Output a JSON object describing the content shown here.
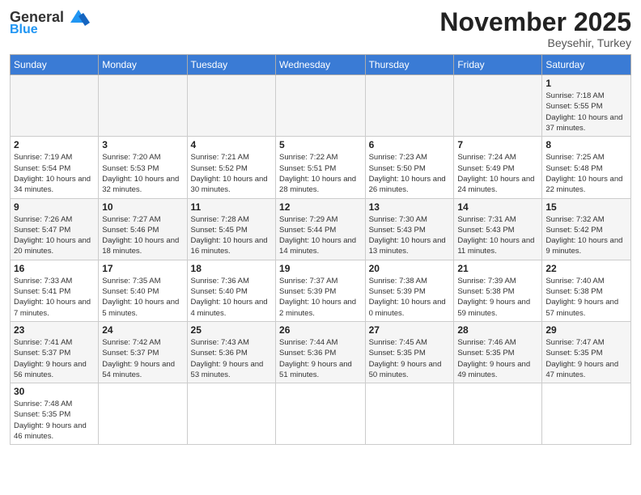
{
  "header": {
    "logo_general": "General",
    "logo_blue": "Blue",
    "month_title": "November 2025",
    "location": "Beysehir, Turkey"
  },
  "weekdays": [
    "Sunday",
    "Monday",
    "Tuesday",
    "Wednesday",
    "Thursday",
    "Friday",
    "Saturday"
  ],
  "weeks": [
    [
      {
        "day": "",
        "info": ""
      },
      {
        "day": "",
        "info": ""
      },
      {
        "day": "",
        "info": ""
      },
      {
        "day": "",
        "info": ""
      },
      {
        "day": "",
        "info": ""
      },
      {
        "day": "",
        "info": ""
      },
      {
        "day": "1",
        "info": "Sunrise: 7:18 AM\nSunset: 5:55 PM\nDaylight: 10 hours and 37 minutes."
      }
    ],
    [
      {
        "day": "2",
        "info": "Sunrise: 7:19 AM\nSunset: 5:54 PM\nDaylight: 10 hours and 34 minutes."
      },
      {
        "day": "3",
        "info": "Sunrise: 7:20 AM\nSunset: 5:53 PM\nDaylight: 10 hours and 32 minutes."
      },
      {
        "day": "4",
        "info": "Sunrise: 7:21 AM\nSunset: 5:52 PM\nDaylight: 10 hours and 30 minutes."
      },
      {
        "day": "5",
        "info": "Sunrise: 7:22 AM\nSunset: 5:51 PM\nDaylight: 10 hours and 28 minutes."
      },
      {
        "day": "6",
        "info": "Sunrise: 7:23 AM\nSunset: 5:50 PM\nDaylight: 10 hours and 26 minutes."
      },
      {
        "day": "7",
        "info": "Sunrise: 7:24 AM\nSunset: 5:49 PM\nDaylight: 10 hours and 24 minutes."
      },
      {
        "day": "8",
        "info": "Sunrise: 7:25 AM\nSunset: 5:48 PM\nDaylight: 10 hours and 22 minutes."
      }
    ],
    [
      {
        "day": "9",
        "info": "Sunrise: 7:26 AM\nSunset: 5:47 PM\nDaylight: 10 hours and 20 minutes."
      },
      {
        "day": "10",
        "info": "Sunrise: 7:27 AM\nSunset: 5:46 PM\nDaylight: 10 hours and 18 minutes."
      },
      {
        "day": "11",
        "info": "Sunrise: 7:28 AM\nSunset: 5:45 PM\nDaylight: 10 hours and 16 minutes."
      },
      {
        "day": "12",
        "info": "Sunrise: 7:29 AM\nSunset: 5:44 PM\nDaylight: 10 hours and 14 minutes."
      },
      {
        "day": "13",
        "info": "Sunrise: 7:30 AM\nSunset: 5:43 PM\nDaylight: 10 hours and 13 minutes."
      },
      {
        "day": "14",
        "info": "Sunrise: 7:31 AM\nSunset: 5:43 PM\nDaylight: 10 hours and 11 minutes."
      },
      {
        "day": "15",
        "info": "Sunrise: 7:32 AM\nSunset: 5:42 PM\nDaylight: 10 hours and 9 minutes."
      }
    ],
    [
      {
        "day": "16",
        "info": "Sunrise: 7:33 AM\nSunset: 5:41 PM\nDaylight: 10 hours and 7 minutes."
      },
      {
        "day": "17",
        "info": "Sunrise: 7:35 AM\nSunset: 5:40 PM\nDaylight: 10 hours and 5 minutes."
      },
      {
        "day": "18",
        "info": "Sunrise: 7:36 AM\nSunset: 5:40 PM\nDaylight: 10 hours and 4 minutes."
      },
      {
        "day": "19",
        "info": "Sunrise: 7:37 AM\nSunset: 5:39 PM\nDaylight: 10 hours and 2 minutes."
      },
      {
        "day": "20",
        "info": "Sunrise: 7:38 AM\nSunset: 5:39 PM\nDaylight: 10 hours and 0 minutes."
      },
      {
        "day": "21",
        "info": "Sunrise: 7:39 AM\nSunset: 5:38 PM\nDaylight: 9 hours and 59 minutes."
      },
      {
        "day": "22",
        "info": "Sunrise: 7:40 AM\nSunset: 5:38 PM\nDaylight: 9 hours and 57 minutes."
      }
    ],
    [
      {
        "day": "23",
        "info": "Sunrise: 7:41 AM\nSunset: 5:37 PM\nDaylight: 9 hours and 56 minutes."
      },
      {
        "day": "24",
        "info": "Sunrise: 7:42 AM\nSunset: 5:37 PM\nDaylight: 9 hours and 54 minutes."
      },
      {
        "day": "25",
        "info": "Sunrise: 7:43 AM\nSunset: 5:36 PM\nDaylight: 9 hours and 53 minutes."
      },
      {
        "day": "26",
        "info": "Sunrise: 7:44 AM\nSunset: 5:36 PM\nDaylight: 9 hours and 51 minutes."
      },
      {
        "day": "27",
        "info": "Sunrise: 7:45 AM\nSunset: 5:35 PM\nDaylight: 9 hours and 50 minutes."
      },
      {
        "day": "28",
        "info": "Sunrise: 7:46 AM\nSunset: 5:35 PM\nDaylight: 9 hours and 49 minutes."
      },
      {
        "day": "29",
        "info": "Sunrise: 7:47 AM\nSunset: 5:35 PM\nDaylight: 9 hours and 47 minutes."
      }
    ],
    [
      {
        "day": "30",
        "info": "Sunrise: 7:48 AM\nSunset: 5:35 PM\nDaylight: 9 hours and 46 minutes."
      },
      {
        "day": "",
        "info": ""
      },
      {
        "day": "",
        "info": ""
      },
      {
        "day": "",
        "info": ""
      },
      {
        "day": "",
        "info": ""
      },
      {
        "day": "",
        "info": ""
      },
      {
        "day": "",
        "info": ""
      }
    ]
  ]
}
